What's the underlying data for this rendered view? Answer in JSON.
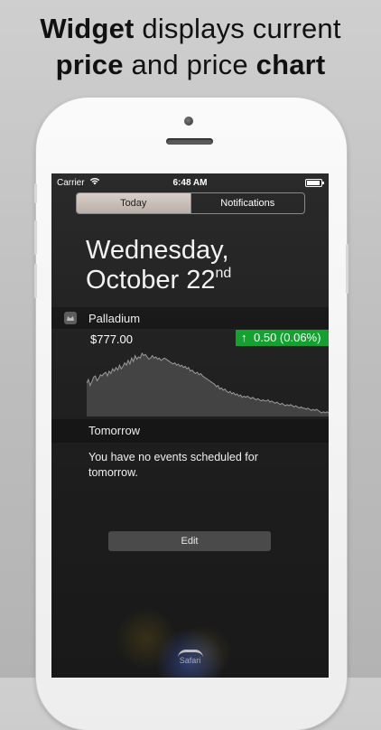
{
  "headline": {
    "line1_bold": "Widget",
    "line1_rest": " displays current",
    "line2_bold1": "price",
    "line2_mid": " and price ",
    "line2_bold2": "chart"
  },
  "status_bar": {
    "carrier": "Carrier",
    "time": "6:48 AM"
  },
  "tabs": [
    {
      "label": "Today",
      "selected": true
    },
    {
      "label": "Notifications",
      "selected": false
    }
  ],
  "date": {
    "weekday": "Wednesday,",
    "month_day": "October 22",
    "suffix": "nd"
  },
  "widget": {
    "title": "Palladium",
    "price": "$777.00",
    "change_arrow": "↑",
    "change": "0.50 (0.06%)",
    "change_color": "#14a130"
  },
  "tomorrow": {
    "label": "Tomorrow",
    "message": "You have no events scheduled for tomorrow."
  },
  "edit_button": "Edit",
  "dock_label": "Safari",
  "chart_data": {
    "type": "area",
    "values": [
      52,
      55,
      50,
      53,
      57,
      58,
      54,
      56,
      59,
      58,
      60,
      61,
      58,
      62,
      60,
      64,
      62,
      65,
      63,
      67,
      64,
      66,
      69,
      67,
      71,
      68,
      73,
      70,
      75,
      72,
      74,
      73,
      77,
      75,
      76,
      74,
      72,
      73,
      75,
      73,
      74,
      72,
      73,
      71,
      72,
      73,
      72,
      71,
      70,
      69,
      68,
      69,
      67,
      68,
      66,
      67,
      65,
      66,
      64,
      65,
      62,
      63,
      61,
      60,
      61,
      59,
      60,
      58,
      57,
      56,
      55,
      54,
      53,
      52,
      51,
      49,
      50,
      47,
      48,
      46,
      47,
      45,
      44,
      45,
      43,
      44,
      42,
      43,
      41,
      42,
      40,
      41,
      40,
      41,
      40,
      39,
      40,
      39,
      38,
      39,
      38,
      37,
      38,
      37,
      37,
      38,
      36,
      37,
      36,
      35,
      36,
      35,
      34,
      35,
      34,
      33,
      34,
      33,
      34,
      33,
      32,
      33,
      32,
      31,
      32,
      31,
      31,
      30,
      31,
      30,
      29,
      30,
      29,
      30,
      29,
      28,
      27,
      28,
      27,
      28,
      27
    ],
    "color": "#6f6f6f"
  }
}
